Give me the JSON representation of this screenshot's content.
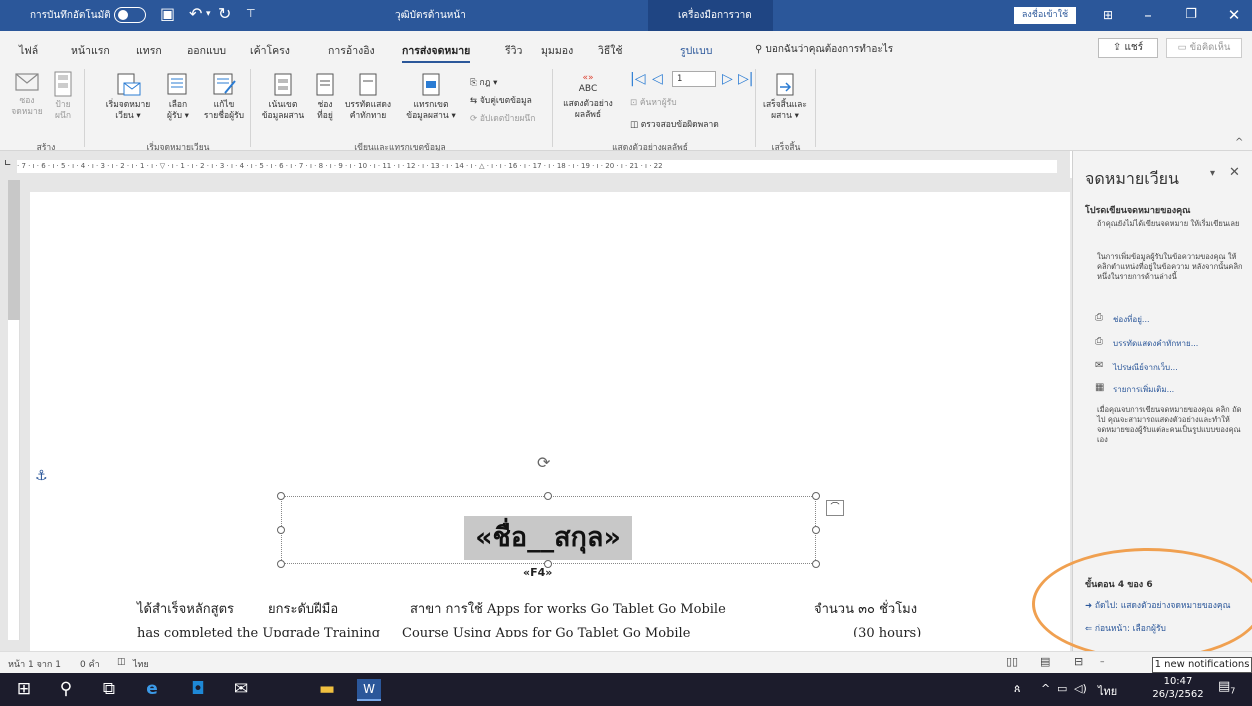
{
  "titlebar": {
    "autosave_label": "การบันทึกอัตโนมัติ",
    "doc_title": "วุฒิบัตรด้านหน้า",
    "context_tab": "เครื่องมือการวาด",
    "signin": "ลงชื่อเข้าใช้",
    "save_icon": "▣",
    "undo_icon": "↶",
    "redo_icon": "↻"
  },
  "tabs": {
    "file": "ไฟล์",
    "home": "หน้าแรก",
    "insert": "แทรก",
    "design": "ออกแบบ",
    "layout": "เค้าโครง",
    "references": "การอ้างอิง",
    "mailings": "การส่งจดหมาย",
    "review": "รีวิว",
    "view": "มุมมอง",
    "help": "วิธีใช้",
    "format": "รูปแบบ",
    "tell_me": "บอกฉันว่าคุณต้องการทำอะไร",
    "share": "แชร์",
    "comments": "ข้อคิดเห็น"
  },
  "ribbon": {
    "envelopes": "ซอง\nจดหมาย",
    "labels": "ป้าย\nผนึก",
    "start_mail_merge": "เริ่มจดหมาย\nเวียน ▾",
    "select_recipients": "เลือก\nผู้รับ ▾",
    "edit_recipient_list": "แก้ไข\nรายชื่อผู้รับ",
    "highlight_fields": "เน้นเขต\nข้อมูลผสาน",
    "address_block": "ช่อง\nที่อยู่",
    "greeting_line": "บรรทัดแสดง\nคำทักทาย",
    "insert_merge_field": "แทรกเขต\nข้อมูลผสาน ▾",
    "rules": "กฎ ▾",
    "match_fields": "จับคู่เขตข้อมูล",
    "update_labels": "อัปเดตป้ายผนึก",
    "preview_results": "แสดงตัวอย่าง\nผลลัพธ์",
    "preview_abc": "ABC",
    "record_number": "1",
    "find_recipient": "ค้นหาผู้รับ",
    "check_errors": "ตรวจสอบข้อผิดพลาด",
    "finish_merge": "เสร็จสิ้นและ\nผสาน ▾",
    "group_create": "สร้าง",
    "group_start": "เริ่มจดหมายเวียน",
    "group_write": "เขียนและแทรกเขตข้อมูล",
    "group_preview": "แสดงตัวอย่างผลลัพธ์",
    "group_finish": "เสร็จสิ้น"
  },
  "ruler": {
    "ticks": "· 7 · ı · 6 · ı · 5 · ı · 4 · ı · 3 · ı · 2 · ı · 1 · ı · ▽ · ı · 1 · ı · 2 · ı · 3 · ı · 4 · ı · 5 · ı · 6 · ı · 7 · ı · 8 · ı · 9 · ı · 10 · ı · 11 · ı · 12 · ı · 13 · ı · 14 · ı · △ · ı · ı · 16 · ı · 17 · ı · 18 · ı · 19 · ı · 20 · ı · 21 · ı · 22"
  },
  "document": {
    "merge_field": "«ชื่อ__สกุล»",
    "f4_field": "«F4»",
    "line1_a": "ได้สำเร็จหลักสูตร",
    "line1_b": "ยกระดับฝีมือ",
    "line1_c": "สาขา  การใช้ Apps for works Go Tablet Go Mobile",
    "line1_d": "จำนวน  ๓๐  ชั่วโมง",
    "line2_a": "has completed  the  Upgrade Training",
    "line2_b": "Course Using Apps for Go Tablet Go Mobile",
    "line2_c": "(30  hours)"
  },
  "pane": {
    "title": "จดหมายเวียน",
    "section1": "โปรดเขียนจดหมายของคุณ",
    "text1": "ถ้าคุณยังไม่ได้เขียนจดหมาย ให้เริ่มเขียนเลย",
    "text2": "ในการเพิ่มข้อมูลผู้รับในข้อความของคุณ ให้คลิกตำแหน่งที่อยู่ในข้อความ หลังจากนั้นคลิกหนึ่งในรายการด้านล่างนี้",
    "link1": "ช่องที่อยู่...",
    "link2": "บรรทัดแสดงคำทักทาย...",
    "link3": "ไปรษณีย์จากเว็บ...",
    "link4": "รายการเพิ่มเติม...",
    "text3": "เมื่อคุณจบการเขียนจดหมายของคุณ คลิก ถัดไป คุณจะสามารถแสดงตัวอย่างและทำให้จดหมายของผู้รับแต่ละคนเป็นรูปแบบของคุณเอง",
    "step": "ขั้นตอน 4 ของ 6",
    "next": "ถัดไป: แสดงตัวอย่างจดหมายของคุณ",
    "prev": "ก่อนหน้า: เลือกผู้รับ"
  },
  "status": {
    "page": "หน้า 1 จาก 1",
    "words": "0 คำ",
    "language": "ไทย",
    "notification": "1 new notifications"
  },
  "taskbar": {
    "lang": "ไทย",
    "time": "10:47",
    "date": "26/3/2562",
    "notif_count": "7"
  },
  "colors": {
    "word_blue": "#2b579a",
    "highlight_orange": "#f0a050",
    "merge_field_gray": "#c8c8c8"
  }
}
